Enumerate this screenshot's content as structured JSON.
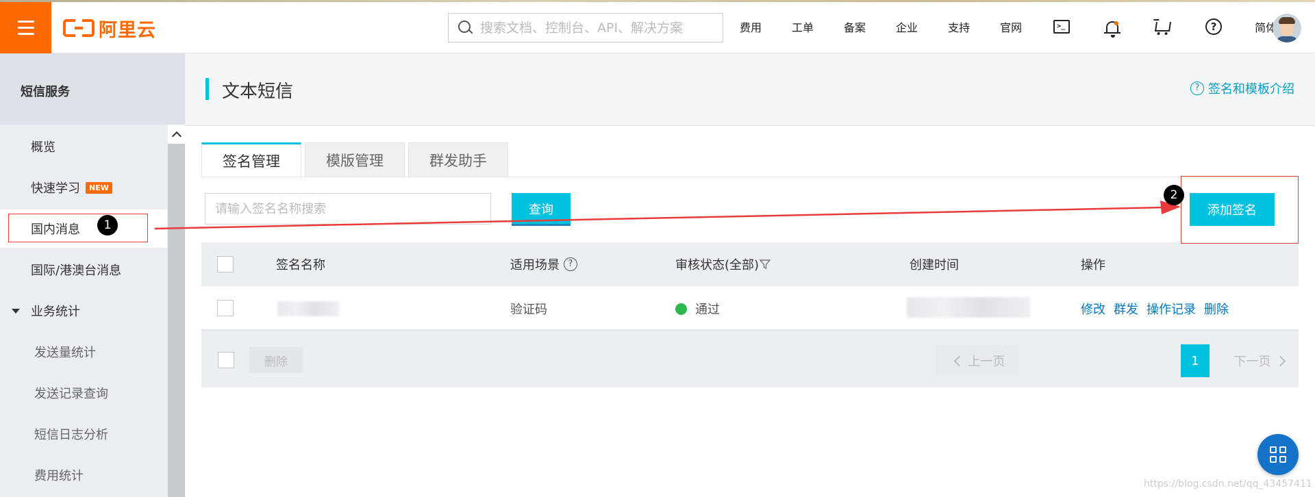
{
  "header": {
    "logo_text": "阿里云",
    "search_placeholder": "搜索文档、控制台、API、解决方案",
    "nav_links": [
      "费用",
      "工单",
      "备案",
      "企业",
      "支持",
      "官网"
    ],
    "lang_label": "简体"
  },
  "sidebar": {
    "title": "短信服务",
    "items": [
      {
        "label": "概览"
      },
      {
        "label": "快速学习",
        "badge": "NEW"
      },
      {
        "label": "国内消息"
      },
      {
        "label": "国际/港澳台消息"
      },
      {
        "label": "业务统计"
      },
      {
        "label": "发送量统计"
      },
      {
        "label": "发送记录查询"
      },
      {
        "label": "短信日志分析"
      },
      {
        "label": "费用统计"
      }
    ]
  },
  "main": {
    "title": "文本短信",
    "intro_link": "签名和模板介绍",
    "tabs": [
      "签名管理",
      "模版管理",
      "群发助手"
    ],
    "search_placeholder": "请输入签名名称搜索",
    "query_label": "查询",
    "add_label": "添加签名",
    "table": {
      "headers": [
        "签名名称",
        "适用场景",
        "审核状态(全部)",
        "创建时间",
        "操作"
      ],
      "rows": [
        {
          "scene": "验证码",
          "status": "通过",
          "actions": [
            "修改",
            "群发",
            "操作记录",
            "删除"
          ]
        }
      ]
    },
    "footer": {
      "delete_label": "删除",
      "prev_label": "上一页",
      "next_label": "下一页",
      "current_page": "1"
    }
  },
  "annotations": {
    "badge1": "1",
    "badge2": "2",
    "highlight_color": "#e93b3b"
  },
  "watermark": "https://blog.csdn.net/qq_43457411",
  "colors": {
    "brand": "#ff6a00",
    "accent": "#00c1de",
    "link": "#0077bb",
    "success": "#2db84d"
  }
}
